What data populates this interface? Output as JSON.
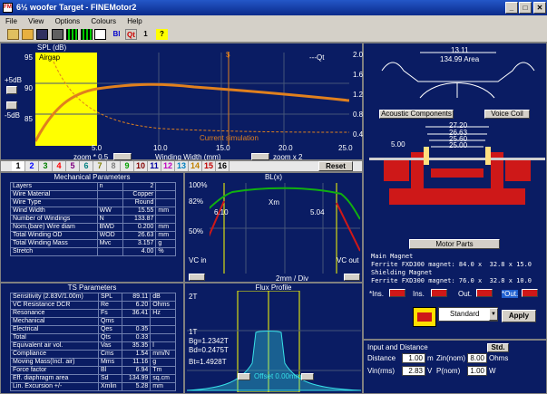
{
  "window": {
    "title": "6½ woofer Target - FINEMotor2",
    "min": "_",
    "max": "□",
    "close": "✕",
    "app_icon": "FM"
  },
  "menu": [
    "File",
    "View",
    "Options",
    "Colours",
    "Help"
  ],
  "toolbar": {
    "icons": [
      "open-icon",
      "folder-icon",
      "save-icon",
      "print-icon",
      "grid-icon",
      "grid2-icon",
      "copy-icon",
      "bl-icon",
      "qt-icon",
      "one-icon",
      "help-icon"
    ],
    "bl": "Bl",
    "qt": "Qt",
    "one": "1",
    "help": "?"
  },
  "spl": {
    "title": "SPL (dB)",
    "airgap": "Airgap",
    "qt_label": "---Qt",
    "plus5": "+5dB",
    "minus5": "-5dB",
    "yticks": [
      "95",
      "90",
      "85",
      "80",
      "75"
    ],
    "y2ticks": [
      "2.0",
      "1.6",
      "1.2",
      "0.8",
      "0.4"
    ],
    "xticks": [
      "5.0",
      "10.0",
      "15.0",
      "20.0",
      "25.0"
    ],
    "zoom1": "zoom * 0.5",
    "xlabel": "Winding Width (mm)",
    "zoom2": "zoom x 2",
    "current": "Current simulation",
    "marker": "$"
  },
  "tabs": [
    "1",
    "2",
    "3",
    "4",
    "5",
    "6",
    "7",
    "8",
    "9",
    "10",
    "11",
    "12",
    "13",
    "14",
    "15",
    "16"
  ],
  "tab_colors": [
    "#000000",
    "#0000ff",
    "#008000",
    "#ff0000",
    "#800080",
    "#008080",
    "#808000",
    "#808080",
    "#00a000",
    "#800000",
    "#0000a0",
    "#c000c0",
    "#0080c0",
    "#c08000",
    "#c00000",
    "#000000"
  ],
  "reset": "Reset",
  "mech": {
    "title": "Mechanical Parameters",
    "rows": [
      [
        "Layers",
        "n",
        "2",
        ""
      ],
      [
        "Wire Material",
        "",
        "Copper",
        ""
      ],
      [
        "Wire Type",
        "",
        "Round",
        ""
      ],
      [
        "Wind Width",
        "WW",
        "15.55",
        "mm"
      ],
      [
        "Number of Windings",
        "N",
        "133.87",
        ""
      ],
      [
        "Nom.(bare) Wire diam",
        "BWD",
        "0.200",
        "mm"
      ],
      [
        "Total Winding OD",
        "WOD",
        "26.63",
        "mm"
      ],
      [
        "Total Winding Mass",
        "Mvc",
        "3.157",
        "g"
      ],
      [
        "Stretch",
        "",
        "4.00",
        "%"
      ]
    ]
  },
  "blx": {
    "title": "BL(x)",
    "p100": "100%",
    "p82": "82%",
    "p50": "50%",
    "l1": "6.10",
    "l2": "5.04",
    "xm": "Xm",
    "vcin": "VC in",
    "vcout": "VC out",
    "div": "2mm / Div"
  },
  "ts": {
    "title": "TS Parameters",
    "rows": [
      [
        "Sensitivity (2.83V/1.00m)",
        "SPL",
        "89.11",
        "dB"
      ],
      [
        "VC Resistance DCR",
        "Re",
        "6.20",
        "Ohms"
      ],
      [
        "Resonance",
        "Fs",
        "36.41",
        "Hz"
      ],
      [
        "Mechanical",
        "Qms",
        "",
        ""
      ],
      [
        "Electrical",
        "Qes",
        "0.35",
        ""
      ],
      [
        "Total",
        "Qts",
        "0.33",
        ""
      ],
      [
        "Equivalent air vol.",
        "Vas",
        "35.35",
        "l"
      ],
      [
        "Compliance",
        "Cms",
        "1.54",
        "mm/N"
      ],
      [
        "Moving Mass(Incl. air)",
        "Mms",
        "11.16",
        "g"
      ],
      [
        "Force factor",
        "Bl",
        "6.94",
        "Tm"
      ],
      [
        "Eff. diaphragm area",
        "Sd",
        "134.99",
        "sq.cm"
      ],
      [
        "Lin. Excursion +/-",
        "Xmlin",
        "5.28",
        "mm"
      ]
    ]
  },
  "flux": {
    "title": "Flux Profile",
    "t2": "2T",
    "t1": "1T",
    "bg": "Bg=1.2342T",
    "bd": "Bd=0.2475T",
    "bt": "Bt=1.4928T",
    "offset": "Offset  0.00mm"
  },
  "driver": {
    "dim1": "13.11",
    "area": "134.99 Area",
    "acoustic": "Acoustic Components",
    "voice": "Voice Coil",
    "d1": "27.20",
    "d2": "26.63",
    "d3": "25.60",
    "d4": "25.00",
    "d5": "5.00"
  },
  "motor": {
    "btn": "Motor Parts",
    "text": "Main Magnet\nFerrite FXD300 magnet: 84.0 x  32.8 x 15.0\nShielding Magnet\nFerrite FXD300 magnet: 76.0 x  32.8 x 10.0",
    "ins1": "*Ins.",
    "ins2": "Ins.",
    "out1": "Out.",
    "out2": "*Out."
  },
  "standard": {
    "value": "Standard",
    "apply": "Apply"
  },
  "input": {
    "title": "Input and Distance",
    "std": "Std.",
    "distance_label": "Distance",
    "distance": "1.00",
    "distance_unit": "m",
    "zin_label": "Zin(nom)",
    "zin": "8.00",
    "zin_unit": "Ohms",
    "vin_label": "Vin(rms)",
    "vin": "2.83",
    "vin_unit": "V",
    "pnom_label": "P(nom)",
    "pnom": "1.00",
    "pnom_unit": "W"
  },
  "colors": {
    "navy": "#0a1c63",
    "curve": "#e0801e",
    "yellow": "#ffff00",
    "red": "#ce1818",
    "blx": "#10b010",
    "flux": "#37e0e8"
  }
}
